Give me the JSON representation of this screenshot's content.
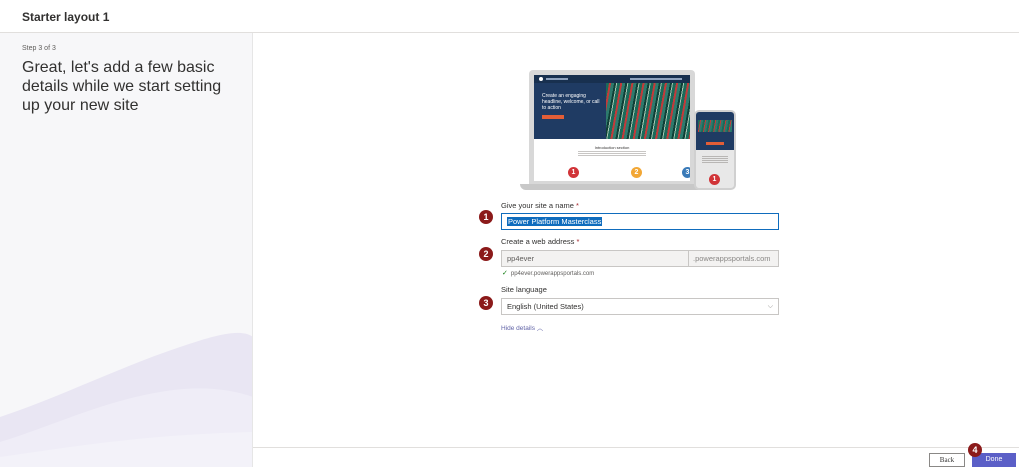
{
  "window": {
    "title": "Starter layout 1"
  },
  "left_panel": {
    "step": "Step 3 of 3",
    "headline": "Great, let's add a few basic details while we start setting up your new site"
  },
  "preview": {
    "hero_text": "Create an engaging headline, welcome, or call to action",
    "intro_heading": "Introduction section",
    "badges": [
      "1",
      "2",
      "3",
      "1"
    ]
  },
  "form": {
    "site_name": {
      "label": "Give your site a name",
      "required_mark": "*",
      "value": "Power Platform Masterclass"
    },
    "web_address": {
      "label": "Create a web address",
      "required_mark": "*",
      "value": "pp4ever",
      "suffix": ".powerappsportals.com",
      "validation": "pp4ever.powerappsportals.com"
    },
    "language": {
      "label": "Site language",
      "value": "English (United States)"
    },
    "hide_details": "Hide details"
  },
  "markers": [
    "1",
    "2",
    "3",
    "4"
  ],
  "footer": {
    "back_label": "Back",
    "done_label": "Done"
  },
  "colors": {
    "accent": "#5b5fc7",
    "marker": "#8b1a1a",
    "focus": "#0f6cbd"
  }
}
